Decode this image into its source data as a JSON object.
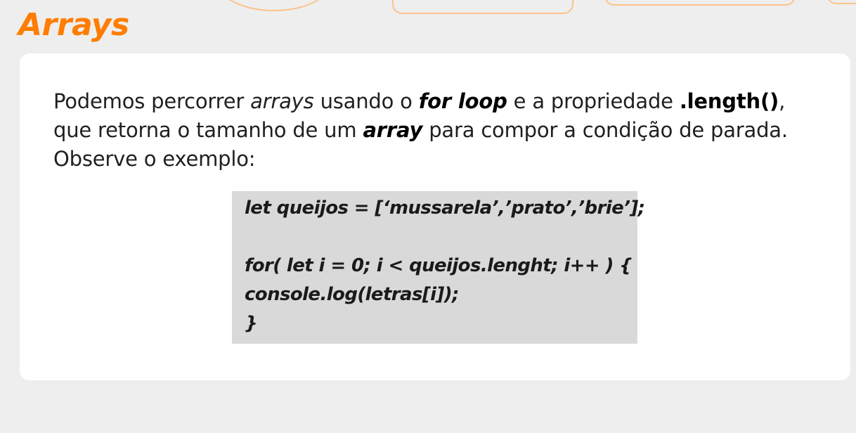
{
  "slide": {
    "title": "Arrays"
  },
  "paragraph": {
    "part1": "Podemos percorrer ",
    "arrays_italic": "arrays",
    "part2": " usando o ",
    "for_loop": "for loop",
    "part3": " e a propriedade ",
    "length": ".length()",
    "part4": ",",
    "part5": "que retorna o tamanho de um ",
    "array": "array",
    "part6": " para compor a condição de parada.",
    "part7": "Observe o exemplo:"
  },
  "code": {
    "lines": [
      "let queijos = [‘mussarela’,’prato’,’brie’];",
      "",
      "for( let i = 0; i < queijos.lenght; i++ ) {",
      "console.log(letras[i]);",
      "}"
    ]
  },
  "colors": {
    "accent": "#ff7d00",
    "decoration": "#fbc28a",
    "background": "#eeeeee",
    "card": "#ffffff",
    "code_background": "#d9d9d9"
  }
}
